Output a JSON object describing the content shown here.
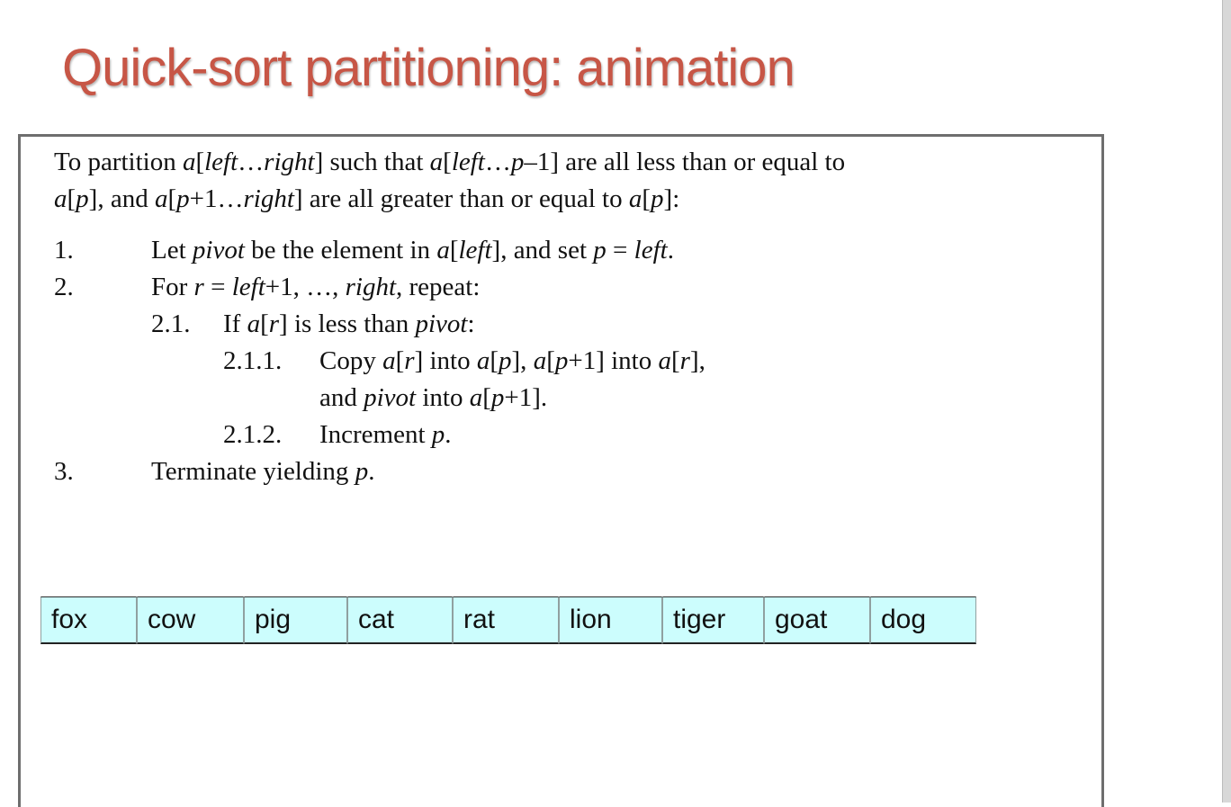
{
  "slide": {
    "title": "Quick-sort partitioning: animation"
  },
  "algorithm": {
    "intro": {
      "line1": {
        "t1": "To partition ",
        "t2": "a",
        "t3": "[",
        "t4": "left",
        "t5": "…",
        "t6": "right",
        "t7": "] such that ",
        "t8": "a",
        "t9": "[",
        "t10": "left",
        "t11": "…",
        "t12": "p",
        "t13": "–1] are all less than or equal to"
      },
      "line2": {
        "t1": "a",
        "t2": "[",
        "t3": "p",
        "t4": "], and ",
        "t5": "a",
        "t6": "[",
        "t7": "p",
        "t8": "+1…",
        "t9": "right",
        "t10": "] are all greater than or equal to ",
        "t11": "a",
        "t12": "[",
        "t13": "p",
        "t14": "]:"
      }
    },
    "step1": {
      "num": "1.",
      "t1": "Let ",
      "t2": "pivot",
      "t3": " be the element in ",
      "t4": "a",
      "t5": "[",
      "t6": "left",
      "t7": "], and set ",
      "t8": "p",
      "t9": " = ",
      "t10": "left",
      "t11": "."
    },
    "step2": {
      "num": "2.",
      "t1": "For ",
      "t2": "r",
      "t3": " = ",
      "t4": "left",
      "t5": "+1, …, ",
      "t6": "right",
      "t7": ", repeat:"
    },
    "step2_1": {
      "num": "2.1.",
      "t1": "If ",
      "t2": "a",
      "t3": "[",
      "t4": "r",
      "t5": "] is less than ",
      "t6": "pivot",
      "t7": ":"
    },
    "step2_1_1": {
      "num": "2.1.1.",
      "line1": {
        "t1": "Copy ",
        "t2": "a",
        "t3": "[",
        "t4": "r",
        "t5": "] into ",
        "t6": "a",
        "t7": "[",
        "t8": "p",
        "t9": "], ",
        "t10": "a",
        "t11": "[",
        "t12": "p",
        "t13": "+1] into ",
        "t14": "a",
        "t15": "[",
        "t16": "r",
        "t17": "],"
      },
      "line2": {
        "t1": "and ",
        "t2": "pivot",
        "t3": " into ",
        "t4": "a",
        "t5": "[",
        "t6": "p",
        "t7": "+1]."
      }
    },
    "step2_1_2": {
      "num": "2.1.2.",
      "t1": "Increment ",
      "t2": "p",
      "t3": "."
    },
    "step3": {
      "num": "3.",
      "t1": "Terminate yielding ",
      "t2": "p",
      "t3": "."
    }
  },
  "array": {
    "cells": [
      "fox",
      "cow",
      "pig",
      "cat",
      "rat",
      "lion",
      "tiger",
      "goat",
      "dog"
    ],
    "cell_color": "#ccfdfd"
  }
}
